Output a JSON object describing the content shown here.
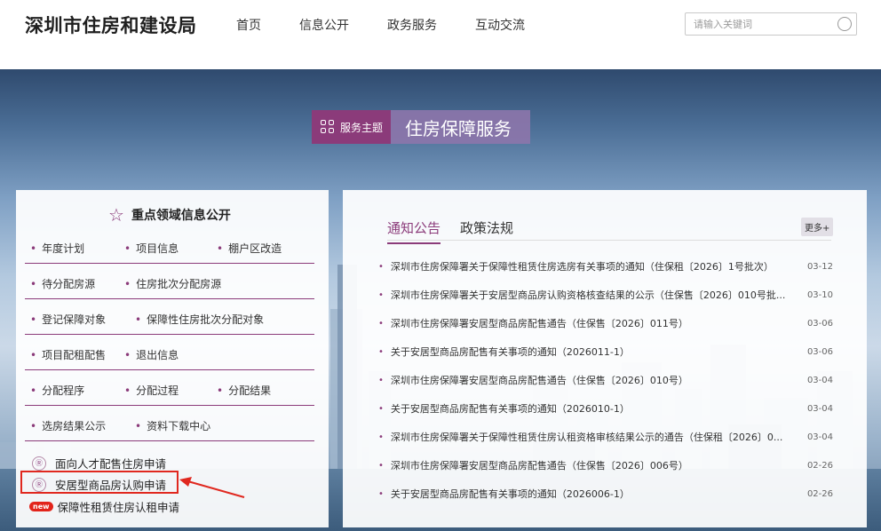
{
  "header": {
    "logo": "深圳市住房和建设局",
    "nav": [
      "首页",
      "信息公开",
      "政务服务",
      "互动交流"
    ],
    "search_placeholder": "请输入关键词"
  },
  "topic": {
    "tag_label": "服务主题",
    "title": "住房保障服务"
  },
  "left_panel": {
    "title": "重点领域信息公开",
    "rows": [
      [
        "年度计划",
        "项目信息",
        "棚户区改造"
      ],
      [
        "待分配房源",
        "住房批次分配房源"
      ],
      [
        "登记保障对象",
        "保障性住房批次分配对象"
      ],
      [
        "项目配租配售",
        "退出信息"
      ],
      [
        "分配程序",
        "分配过程",
        "分配结果"
      ],
      [
        "选房结果公示",
        "资料下载中心"
      ]
    ],
    "apply_items": [
      {
        "label": "面向人才配售住房申请",
        "icon": "apply-icon"
      },
      {
        "label": "安居型商品房认购申请",
        "icon": "apply-icon"
      },
      {
        "label": "保障性租赁住房认租申请",
        "icon": "new-icon",
        "badge": "new"
      }
    ]
  },
  "right_panel": {
    "tabs": [
      "通知公告",
      "政策法规"
    ],
    "active_tab": 0,
    "more_label": "更多+",
    "news": [
      {
        "title": "深圳市住房保障署关于保障性租赁住房选房有关事项的通知（住保租〔2026〕1号批次）",
        "date": "03-12"
      },
      {
        "title": "深圳市住房保障署关于安居型商品房认购资格核查结果的公示（住保售〔2026〕010号批...",
        "date": "03-10"
      },
      {
        "title": "深圳市住房保障署安居型商品房配售通告（住保售〔2026〕011号）",
        "date": "03-06"
      },
      {
        "title": "关于安居型商品房配售有关事项的通知（2026011-1）",
        "date": "03-06"
      },
      {
        "title": "深圳市住房保障署安居型商品房配售通告（住保售〔2026〕010号）",
        "date": "03-04"
      },
      {
        "title": "关于安居型商品房配售有关事项的通知（2026010-1）",
        "date": "03-04"
      },
      {
        "title": "深圳市住房保障署关于保障性租赁住房认租资格审核结果公示的通告（住保租〔2026〕0...",
        "date": "03-04"
      },
      {
        "title": "深圳市住房保障署安居型商品房配售通告（住保售〔2026〕006号）",
        "date": "02-26"
      },
      {
        "title": "关于安居型商品房配售有关事项的通知（2026006-1）",
        "date": "02-26"
      }
    ]
  },
  "colors": {
    "accent": "#8b3b7a",
    "highlight": "#e0281f"
  }
}
